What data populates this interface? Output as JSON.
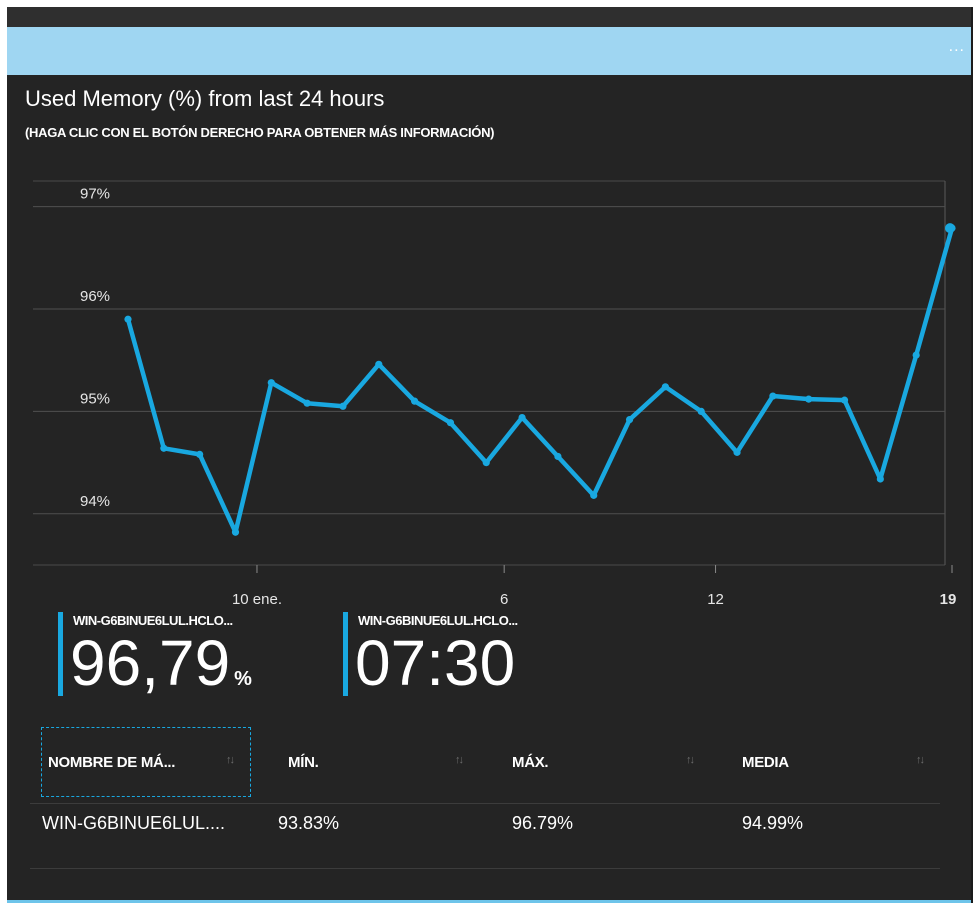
{
  "header": {
    "more_label": "..."
  },
  "title": "Used Memory (%) from last 24 hours",
  "subtitle": "(HAGA CLIC CON EL BOTÓN DERECHO PARA OBTENER MÁS INFORMACIÓN)",
  "colors": {
    "series": "#19a8e0",
    "header": "#9fd6f2",
    "panel": "#242424"
  },
  "chart_data": {
    "type": "line",
    "title": "Used Memory (%) from last 24 hours",
    "xlabel": "",
    "ylabel": "",
    "ylim": [
      93.5,
      97.25
    ],
    "y_ticks": [
      97,
      96,
      95,
      94
    ],
    "y_tick_labels": [
      "97%",
      "96%",
      "95%",
      "94%"
    ],
    "x_tick_labels": [
      "10 ene.",
      "6",
      "12",
      "19"
    ],
    "grid": true,
    "series": [
      {
        "name": "WIN-G6BINUE6LUL.HCLO...",
        "values": [
          95.9,
          94.64,
          94.58,
          93.82,
          95.28,
          95.08,
          95.05,
          95.46,
          95.1,
          94.89,
          94.5,
          94.94,
          94.56,
          94.18,
          94.92,
          95.24,
          95.0,
          94.6,
          95.15,
          95.12,
          95.11,
          94.34,
          95.55,
          96.79
        ]
      }
    ]
  },
  "kpis": [
    {
      "label": "WIN-G6BINUE6LUL.HCLO...",
      "value": "96,79",
      "unit": "%"
    },
    {
      "label": "WIN-G6BINUE6LUL.HCLO...",
      "value": "07:30",
      "unit": ""
    }
  ],
  "table": {
    "columns": [
      "NOMBRE DE MÁ...",
      "MÍN.",
      "MÁX.",
      "MEDIA"
    ],
    "sort_icon": "↑↓",
    "rows": [
      [
        "WIN-G6BINUE6LUL....",
        "93.83%",
        "96.79%",
        "94.99%"
      ]
    ]
  }
}
